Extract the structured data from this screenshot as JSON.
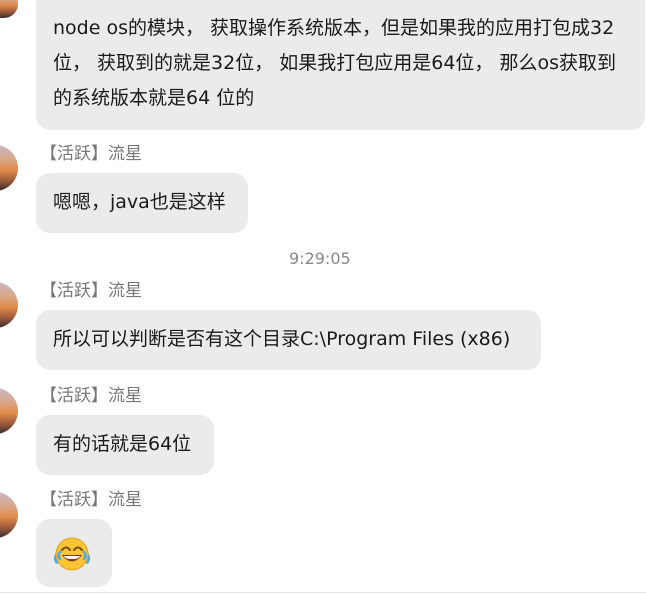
{
  "messages": {
    "m1": "node os的模块， 获取操作系统版本，但是如果我的应用打包成32位， 获取到的就是32位， 如果我打包应用是64位， 那么os获取到的系统版本就是64 位的",
    "m2": "嗯嗯，java也是这样",
    "m3": "所以可以判断是否有这个目录C:\\Program Files (x86)",
    "m4": "有的话就是64位",
    "m5_emoji": "tears-of-joy-emoji"
  },
  "sender": {
    "name": "【活跃】流星"
  },
  "timestamp": "9:29:05",
  "colors": {
    "bubble": "#ebebeb",
    "text": "#1a1a1a",
    "meta": "#777777"
  }
}
